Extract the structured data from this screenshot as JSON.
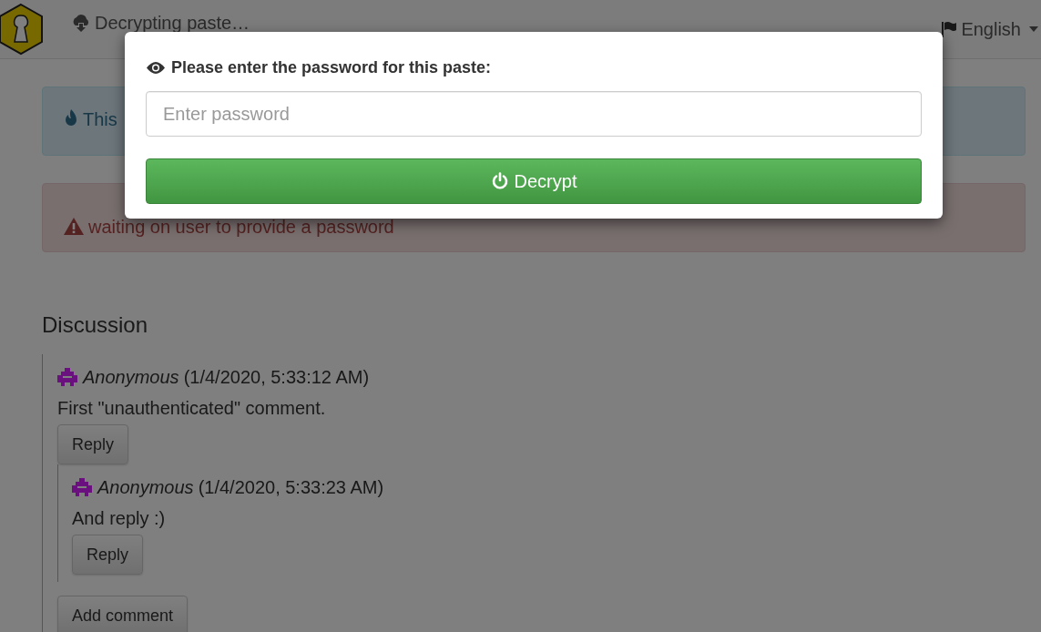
{
  "header": {
    "status": "Decrypting paste…",
    "language": "English"
  },
  "alerts": [
    {
      "kind": "info",
      "text": "This"
    },
    {
      "kind": "danger",
      "text": "waiting on user to provide a password"
    }
  ],
  "discussion": {
    "title": "Discussion",
    "comments": [
      {
        "author": "Anonymous",
        "date": "(1/4/2020, 5:33:12 AM)",
        "text": "First \"unauthenticated\" comment.",
        "reply_button": "Reply",
        "children": [
          {
            "author": "Anonymous",
            "date": "(1/4/2020, 5:33:23 AM)",
            "text": "And reply :)",
            "reply_button": "Reply"
          }
        ]
      }
    ],
    "add_button": "Add comment"
  },
  "modal": {
    "title": "Please enter the password for this paste:",
    "placeholder": "Enter password",
    "button": "Decrypt"
  }
}
